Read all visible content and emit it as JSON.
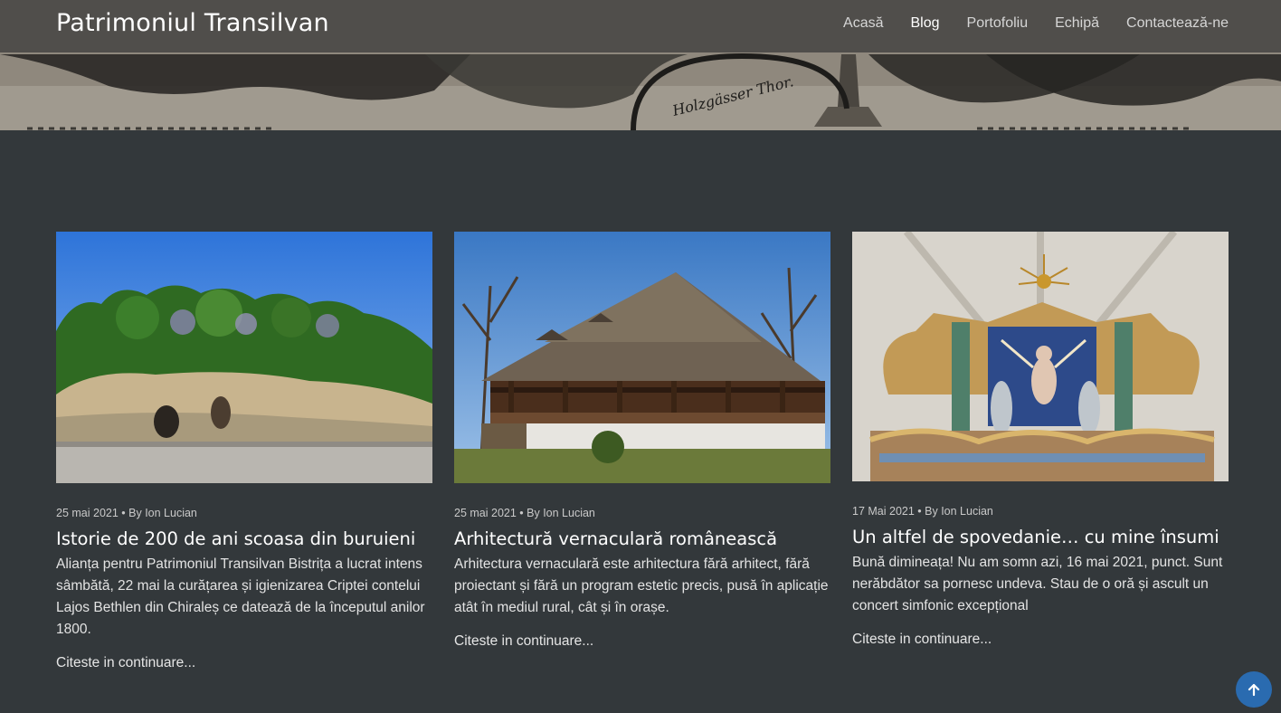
{
  "site": {
    "brand": "Patrimoniul Transilvan"
  },
  "nav": {
    "items": [
      {
        "label": "Acasă",
        "active": false
      },
      {
        "label": "Blog",
        "active": true
      },
      {
        "label": "Portofoliu",
        "active": false
      },
      {
        "label": "Echipă",
        "active": false
      },
      {
        "label": "Contactează-ne",
        "active": false
      }
    ]
  },
  "hero": {
    "caption": "Holzgässer Thor."
  },
  "posts": [
    {
      "date": "25 mai 2021",
      "author": "By Ion Lucian",
      "title": "Istorie de 200 de ani scoasa din buruieni",
      "excerpt": "Alianța pentru Patrimoniul Transilvan Bistrița a lucrat intens sâmbătă, 22 mai la curățarea și igienizarea Criptei contelui Lajos Bethlen din Chiraleș ce datează de la începutul anilor 1800.",
      "more": "Citeste in continuare..."
    },
    {
      "date": "25 mai 2021",
      "author": "By Ion Lucian",
      "title": "Arhitectură vernaculară românească",
      "excerpt": "Arhitectura vernaculară este arhitectura fără arhitect, fără proiectant și fără un program estetic precis, pusă în aplicație atât în mediul rural, cât și în orașe.",
      "more": "Citeste in continuare..."
    },
    {
      "date": "17 Mai 2021",
      "author": "By Ion Lucian",
      "title": "Un altfel de spovedanie… cu mine însumi",
      "excerpt": "Bună dimineața! Nu am somn azi, 16 mai 2021, punct. Sunt nerăbdător sa pornesc undeva. Stau de o oră și ascult un concert simfonic excepțional",
      "more": "Citeste in continuare..."
    }
  ],
  "colors": {
    "background": "#33383b",
    "accent": "#2a6bb0"
  },
  "icons": {
    "back_to_top": "arrow-up-icon"
  }
}
